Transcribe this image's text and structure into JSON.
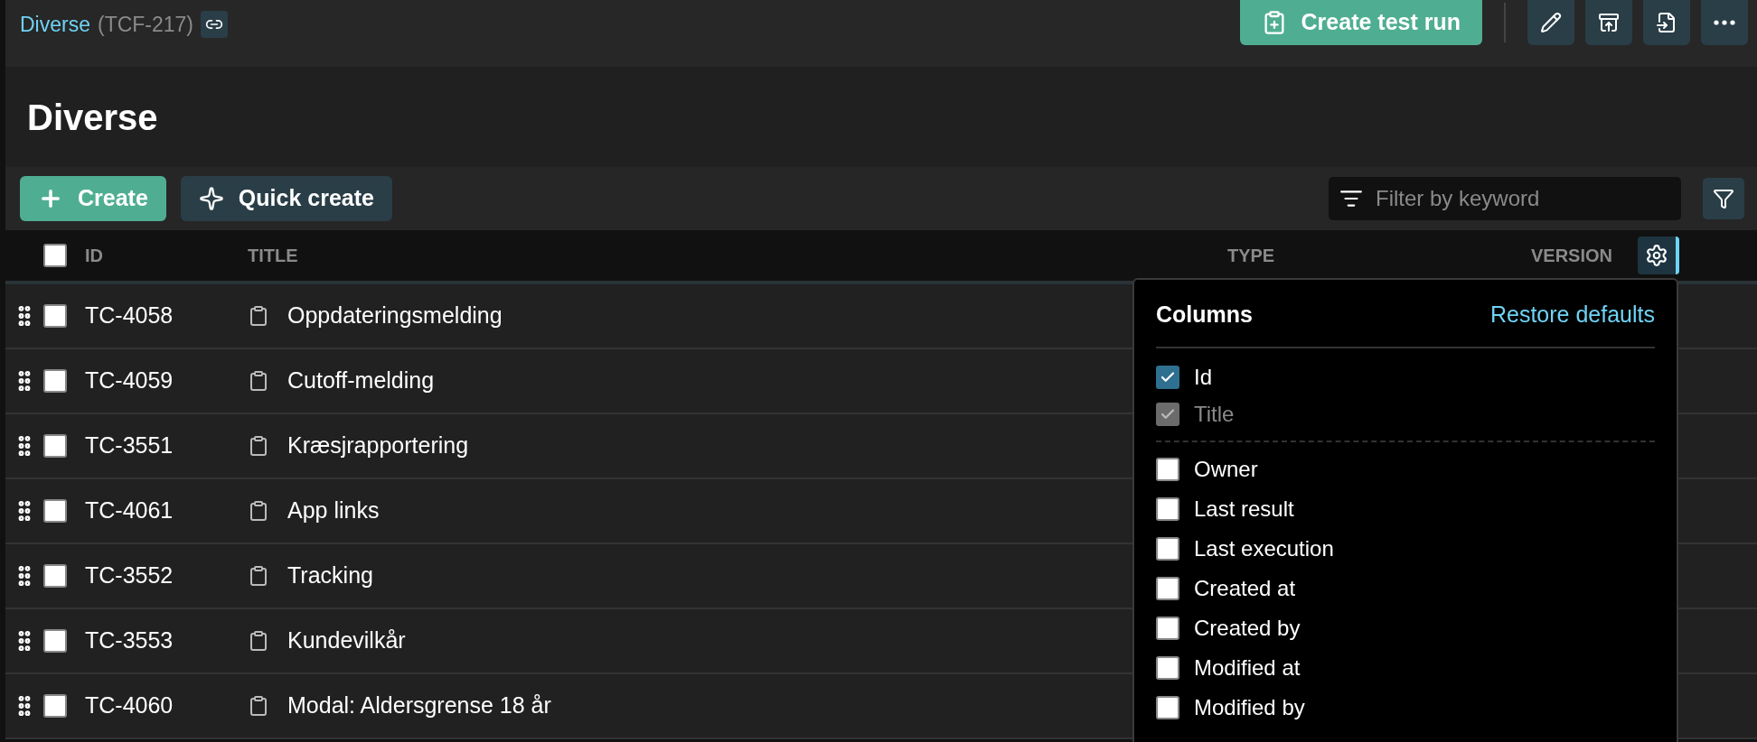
{
  "breadcrumb": {
    "name": "Diverse",
    "key": "(TCF-217)"
  },
  "actions": {
    "primary": "Create test run"
  },
  "page_title": "Diverse",
  "toolbar": {
    "create": "Create",
    "quick_create": "Quick create",
    "filter": {
      "placeholder": "Filter by keyword"
    }
  },
  "table": {
    "select_all": {
      "checked": false
    },
    "columns": [
      "ID",
      "TITLE",
      "TYPE",
      "VERSION"
    ],
    "rows": [
      {
        "id": "TC-4058",
        "title": "Oppdateringsmelding",
        "checked": false
      },
      {
        "id": "TC-4059",
        "title": "Cutoff-melding",
        "checked": false
      },
      {
        "id": "TC-3551",
        "title": "Kræsjrapportering",
        "checked": false
      },
      {
        "id": "TC-4061",
        "title": "App links",
        "checked": false
      },
      {
        "id": "TC-3552",
        "title": "Tracking",
        "checked": false
      },
      {
        "id": "TC-3553",
        "title": "Kundevilkår",
        "checked": false
      },
      {
        "id": "TC-4060",
        "title": "Modal: Aldersgrense 18 år",
        "checked": false
      }
    ]
  },
  "columns_menu": {
    "title": "Columns",
    "restore": "Restore defaults",
    "fixed": [
      {
        "label": "Id",
        "checked": true,
        "disabled": false
      },
      {
        "label": "Title",
        "checked": true,
        "disabled": true
      }
    ],
    "optional": [
      {
        "label": "Owner",
        "checked": false
      },
      {
        "label": "Last result",
        "checked": false
      },
      {
        "label": "Last execution",
        "checked": false
      },
      {
        "label": "Created at",
        "checked": false
      },
      {
        "label": "Created by",
        "checked": false
      },
      {
        "label": "Modified at",
        "checked": false
      },
      {
        "label": "Modified by",
        "checked": false
      }
    ]
  }
}
